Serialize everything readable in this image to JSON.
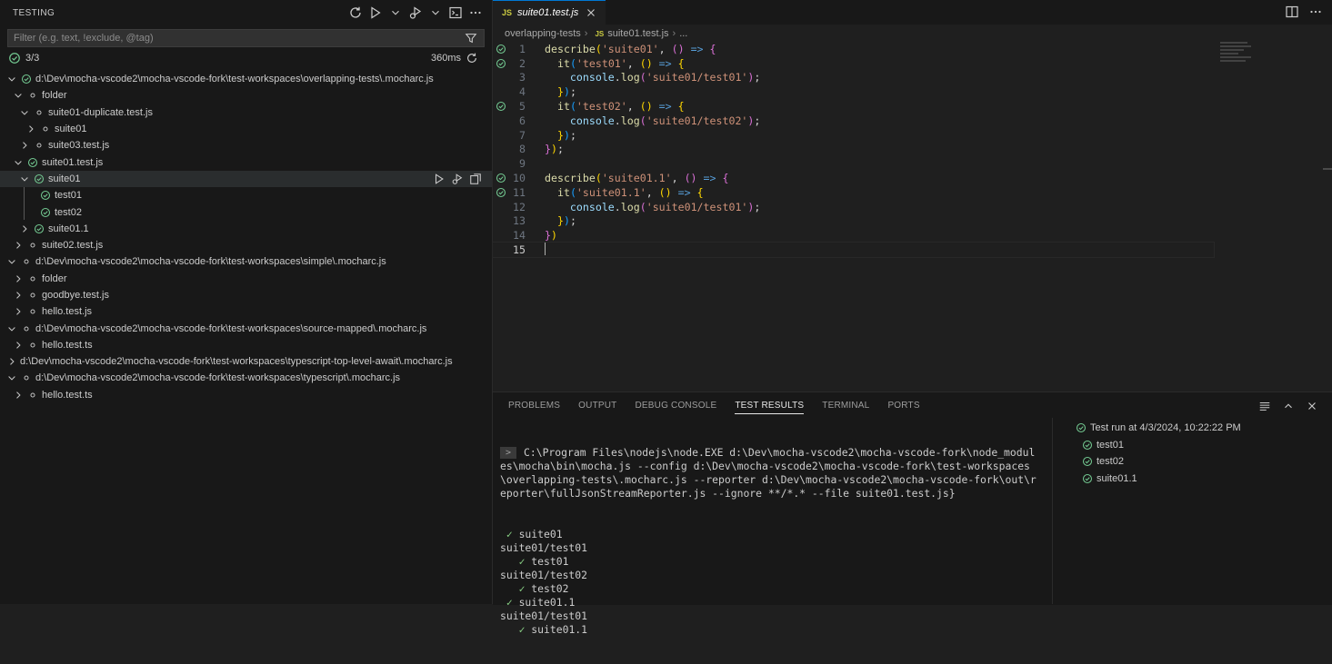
{
  "sidebar": {
    "title": "TESTING",
    "filter_placeholder": "Filter (e.g. text, !exclude, @tag)",
    "summary": {
      "count": "3/3",
      "duration": "360ms"
    },
    "tree": [
      {
        "label": "d:\\Dev\\mocha-vscode2\\mocha-vscode-fork\\test-workspaces\\overlapping-tests\\.mocharc.js",
        "depth": 0,
        "chevron": "down",
        "status": "passed"
      },
      {
        "label": "folder",
        "depth": 1,
        "chevron": "down",
        "status": "unset"
      },
      {
        "label": "suite01-duplicate.test.js",
        "depth": 2,
        "chevron": "down",
        "status": "unset"
      },
      {
        "label": "suite01",
        "depth": 3,
        "chevron": "right",
        "status": "unset"
      },
      {
        "label": "suite03.test.js",
        "depth": 2,
        "chevron": "right",
        "status": "unset"
      },
      {
        "label": "suite01.test.js",
        "depth": 1,
        "chevron": "down",
        "status": "passed"
      },
      {
        "label": "suite01",
        "depth": 2,
        "chevron": "down",
        "status": "passed",
        "selected": true
      },
      {
        "label": "test01",
        "depth": 3,
        "chevron": "none",
        "status": "passed"
      },
      {
        "label": "test02",
        "depth": 3,
        "chevron": "none",
        "status": "passed"
      },
      {
        "label": "suite01.1",
        "depth": 2,
        "chevron": "right",
        "status": "passed"
      },
      {
        "label": "suite02.test.js",
        "depth": 1,
        "chevron": "right",
        "status": "unset"
      },
      {
        "label": "d:\\Dev\\mocha-vscode2\\mocha-vscode-fork\\test-workspaces\\simple\\.mocharc.js",
        "depth": 0,
        "chevron": "down",
        "status": "unset"
      },
      {
        "label": "folder",
        "depth": 1,
        "chevron": "right",
        "status": "unset"
      },
      {
        "label": "goodbye.test.js",
        "depth": 1,
        "chevron": "right",
        "status": "unset"
      },
      {
        "label": "hello.test.js",
        "depth": 1,
        "chevron": "right",
        "status": "unset"
      },
      {
        "label": "d:\\Dev\\mocha-vscode2\\mocha-vscode-fork\\test-workspaces\\source-mapped\\.mocharc.js",
        "depth": 0,
        "chevron": "down",
        "status": "unset"
      },
      {
        "label": "hello.test.ts",
        "depth": 1,
        "chevron": "right",
        "status": "unset"
      },
      {
        "label": "d:\\Dev\\mocha-vscode2\\mocha-vscode-fork\\test-workspaces\\typescript-top-level-await\\.mocharc.js",
        "depth": 0,
        "chevron": "right",
        "status": "none"
      },
      {
        "label": "d:\\Dev\\mocha-vscode2\\mocha-vscode-fork\\test-workspaces\\typescript\\.mocharc.js",
        "depth": 0,
        "chevron": "down",
        "status": "unset"
      },
      {
        "label": "hello.test.ts",
        "depth": 1,
        "chevron": "right",
        "status": "unset"
      }
    ]
  },
  "editor": {
    "tab_icon": "JS",
    "tab_name": "suite01.test.js",
    "breadcrumb": [
      "overlapping-tests",
      "suite01.test.js",
      "..."
    ],
    "breadcrumb_icon": "JS",
    "lines": [
      {
        "n": "1",
        "gutter": true,
        "tokens": [
          [
            "f",
            "describe"
          ],
          [
            "b1",
            "("
          ],
          [
            "s",
            "'suite01'"
          ],
          [
            "p",
            ", "
          ],
          [
            "b2",
            "()"
          ],
          [
            "a",
            " => "
          ],
          [
            "b2",
            "{"
          ]
        ]
      },
      {
        "n": "2",
        "gutter": true,
        "tokens": [
          [
            "p",
            "  "
          ],
          [
            "f",
            "it"
          ],
          [
            "b3",
            "("
          ],
          [
            "s",
            "'test01'"
          ],
          [
            "p",
            ", "
          ],
          [
            "b1",
            "()"
          ],
          [
            "a",
            " => "
          ],
          [
            "b1",
            "{"
          ]
        ]
      },
      {
        "n": "3",
        "gutter": false,
        "tokens": [
          [
            "p",
            "    "
          ],
          [
            "v",
            "console"
          ],
          [
            "p",
            "."
          ],
          [
            "f",
            "log"
          ],
          [
            "b2",
            "("
          ],
          [
            "s",
            "'suite01/test01'"
          ],
          [
            "b2",
            ")"
          ],
          [
            "p",
            ";"
          ]
        ]
      },
      {
        "n": "4",
        "gutter": false,
        "tokens": [
          [
            "p",
            "  "
          ],
          [
            "b1",
            "}"
          ],
          [
            "b3",
            ")"
          ],
          [
            "p",
            ";"
          ]
        ]
      },
      {
        "n": "5",
        "gutter": true,
        "tokens": [
          [
            "p",
            "  "
          ],
          [
            "f",
            "it"
          ],
          [
            "b3",
            "("
          ],
          [
            "s",
            "'test02'"
          ],
          [
            "p",
            ", "
          ],
          [
            "b1",
            "()"
          ],
          [
            "a",
            " => "
          ],
          [
            "b1",
            "{"
          ]
        ]
      },
      {
        "n": "6",
        "gutter": false,
        "tokens": [
          [
            "p",
            "    "
          ],
          [
            "v",
            "console"
          ],
          [
            "p",
            "."
          ],
          [
            "f",
            "log"
          ],
          [
            "b2",
            "("
          ],
          [
            "s",
            "'suite01/test02'"
          ],
          [
            "b2",
            ")"
          ],
          [
            "p",
            ";"
          ]
        ]
      },
      {
        "n": "7",
        "gutter": false,
        "tokens": [
          [
            "p",
            "  "
          ],
          [
            "b1",
            "}"
          ],
          [
            "b3",
            ")"
          ],
          [
            "p",
            ";"
          ]
        ]
      },
      {
        "n": "8",
        "gutter": false,
        "tokens": [
          [
            "b2",
            "}"
          ],
          [
            "b1",
            ")"
          ],
          [
            "p",
            ";"
          ]
        ]
      },
      {
        "n": "9",
        "gutter": false,
        "tokens": []
      },
      {
        "n": "10",
        "gutter": true,
        "tokens": [
          [
            "f",
            "describe"
          ],
          [
            "b1",
            "("
          ],
          [
            "s",
            "'suite01.1'"
          ],
          [
            "p",
            ", "
          ],
          [
            "b2",
            "()"
          ],
          [
            "a",
            " => "
          ],
          [
            "b2",
            "{"
          ]
        ]
      },
      {
        "n": "11",
        "gutter": true,
        "tokens": [
          [
            "p",
            "  "
          ],
          [
            "f",
            "it"
          ],
          [
            "b3",
            "("
          ],
          [
            "s",
            "'suite01.1'"
          ],
          [
            "p",
            ", "
          ],
          [
            "b1",
            "()"
          ],
          [
            "a",
            " => "
          ],
          [
            "b1",
            "{"
          ]
        ]
      },
      {
        "n": "12",
        "gutter": false,
        "tokens": [
          [
            "p",
            "    "
          ],
          [
            "v",
            "console"
          ],
          [
            "p",
            "."
          ],
          [
            "f",
            "log"
          ],
          [
            "b2",
            "("
          ],
          [
            "s",
            "'suite01/test01'"
          ],
          [
            "b2",
            ")"
          ],
          [
            "p",
            ";"
          ]
        ]
      },
      {
        "n": "13",
        "gutter": false,
        "tokens": [
          [
            "p",
            "  "
          ],
          [
            "b1",
            "}"
          ],
          [
            "b3",
            ")"
          ],
          [
            "p",
            ";"
          ]
        ]
      },
      {
        "n": "14",
        "gutter": false,
        "tokens": [
          [
            "b2",
            "}"
          ],
          [
            "b1",
            ")"
          ]
        ]
      },
      {
        "n": "15",
        "gutter": false,
        "tokens": [],
        "active": true
      }
    ]
  },
  "panel": {
    "tabs": [
      "PROBLEMS",
      "OUTPUT",
      "DEBUG CONSOLE",
      "TEST RESULTS",
      "TERMINAL",
      "PORTS"
    ],
    "active_tab": "TEST RESULTS",
    "prompt_glyph": ">",
    "command": "C:\\Program Files\\nodejs\\node.EXE d:\\Dev\\mocha-vscode2\\mocha-vscode-fork\\node_modules\\mocha\\bin\\mocha.js --config d:\\Dev\\mocha-vscode2\\mocha-vscode-fork\\test-workspaces\\overlapping-tests\\.mocharc.js --reporter d:\\Dev\\mocha-vscode2\\mocha-vscode-fork\\out\\reporter\\fullJsonStreamReporter.js --ignore **/*.* --file suite01.test.js}",
    "output": [
      {
        "indent": " ",
        "check": true,
        "text": "suite01"
      },
      {
        "indent": "",
        "check": false,
        "text": "suite01/test01"
      },
      {
        "indent": "   ",
        "check": true,
        "text": "test01"
      },
      {
        "indent": "",
        "check": false,
        "text": "suite01/test02"
      },
      {
        "indent": "   ",
        "check": true,
        "text": "test02"
      },
      {
        "indent": " ",
        "check": true,
        "text": "suite01.1"
      },
      {
        "indent": "",
        "check": false,
        "text": "suite01/test01"
      },
      {
        "indent": "   ",
        "check": true,
        "text": "suite01.1"
      }
    ],
    "check_glyph": "✓",
    "results": {
      "run_label": "Test run at 4/3/2024, 10:22:22 PM",
      "items": [
        "test01",
        "test02",
        "suite01.1"
      ]
    }
  },
  "colors": {
    "passed": "#73c991",
    "unset": "#c5c5c5",
    "accent": "#0078d4"
  }
}
